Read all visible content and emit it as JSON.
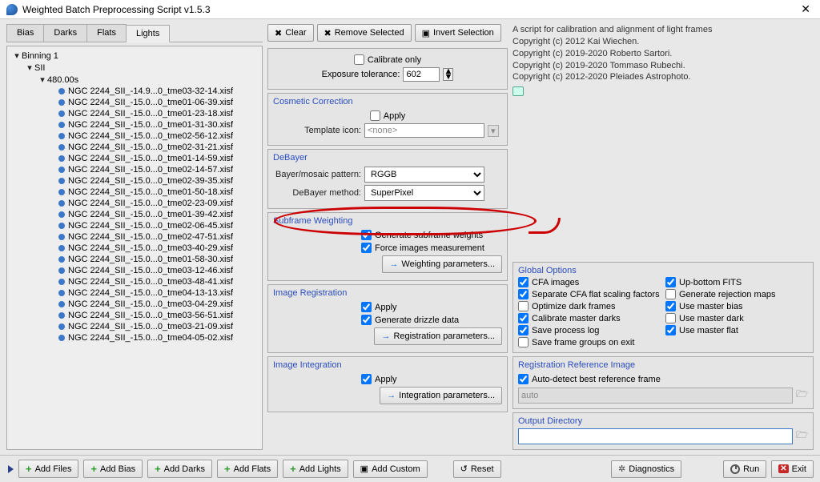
{
  "window": {
    "title": "Weighted Batch Preprocessing Script v1.5.3"
  },
  "tabs": [
    "Bias",
    "Darks",
    "Flats",
    "Lights"
  ],
  "active_tab": 3,
  "tree": {
    "root": "Binning 1",
    "filter": "SII",
    "exposure": "480.00s",
    "files": [
      "NGC 2244_SII_-14.9...0_tme03-32-14.xisf",
      "NGC 2244_SII_-15.0...0_tme01-06-39.xisf",
      "NGC 2244_SII_-15.0...0_tme01-23-18.xisf",
      "NGC 2244_SII_-15.0...0_tme01-31-30.xisf",
      "NGC 2244_SII_-15.0...0_tme02-56-12.xisf",
      "NGC 2244_SII_-15.0...0_tme02-31-21.xisf",
      "NGC 2244_SII_-15.0...0_tme01-14-59.xisf",
      "NGC 2244_SII_-15.0...0_tme02-14-57.xisf",
      "NGC 2244_SII_-15.0...0_tme02-39-35.xisf",
      "NGC 2244_SII_-15.0...0_tme01-50-18.xisf",
      "NGC 2244_SII_-15.0...0_tme02-23-09.xisf",
      "NGC 2244_SII_-15.0...0_tme01-39-42.xisf",
      "NGC 2244_SII_-15.0...0_tme02-06-45.xisf",
      "NGC 2244_SII_-15.0...0_tme02-47-51.xisf",
      "NGC 2244_SII_-15.0...0_tme03-40-29.xisf",
      "NGC 2244_SII_-15.0...0_tme01-58-30.xisf",
      "NGC 2244_SII_-15.0...0_tme03-12-46.xisf",
      "NGC 2244_SII_-15.0...0_tme03-48-41.xisf",
      "NGC 2244_SII_-15.0...0_tme04-13-13.xisf",
      "NGC 2244_SII_-15.0...0_tme03-04-29.xisf",
      "NGC 2244_SII_-15.0...0_tme03-56-51.xisf",
      "NGC 2244_SII_-15.0...0_tme03-21-09.xisf",
      "NGC 2244_SII_-15.0...0_tme04-05-02.xisf"
    ]
  },
  "top_buttons": {
    "clear": "Clear",
    "remove": "Remove Selected",
    "invert": "Invert Selection"
  },
  "calibrate_only": {
    "label": "Calibrate only",
    "checked": false
  },
  "exposure_tol": {
    "label": "Exposure tolerance:",
    "value": "602"
  },
  "cosmetic": {
    "title": "Cosmetic Correction",
    "apply": {
      "label": "Apply",
      "checked": false
    },
    "tmpl_label": "Template icon:",
    "tmpl_value": "<none>"
  },
  "debayer": {
    "title": "DeBayer",
    "pattern_label": "Bayer/mosaic pattern:",
    "pattern_value": "RGGB",
    "method_label": "DeBayer method:",
    "method_value": "SuperPixel"
  },
  "subframe": {
    "title": "Subframe Weighting",
    "gen": {
      "label": "Generate subframe weights",
      "checked": true
    },
    "force": {
      "label": "Force images measurement",
      "checked": true
    },
    "btn": "Weighting parameters..."
  },
  "registration": {
    "title": "Image Registration",
    "apply": {
      "label": "Apply",
      "checked": true
    },
    "drizzle": {
      "label": "Generate drizzle data",
      "checked": true
    },
    "btn": "Registration parameters..."
  },
  "integration": {
    "title": "Image Integration",
    "apply": {
      "label": "Apply",
      "checked": true
    },
    "btn": "Integration parameters..."
  },
  "info": {
    "l1": "A script for calibration and alignment of light frames",
    "l2": "Copyright (c) 2012 Kai Wiechen.",
    "l3": "Copyright (c) 2019-2020 Roberto Sartori.",
    "l4": "Copyright (c) 2019-2020 Tommaso Rubechi.",
    "l5": "Copyright (c) 2012-2020 Pleiades Astrophoto."
  },
  "global": {
    "title": "Global Options",
    "left": [
      {
        "label": "CFA images",
        "checked": true
      },
      {
        "label": "Separate CFA flat scaling factors",
        "checked": true
      },
      {
        "label": "Optimize dark frames",
        "checked": false
      },
      {
        "label": "Calibrate master darks",
        "checked": true
      },
      {
        "label": "Save process log",
        "checked": true
      },
      {
        "label": "Save frame groups on exit",
        "checked": false
      }
    ],
    "right": [
      {
        "label": "Up-bottom FITS",
        "checked": true
      },
      {
        "label": "Generate rejection maps",
        "checked": false
      },
      {
        "label": "Use master bias",
        "checked": true
      },
      {
        "label": "Use master dark",
        "checked": false
      },
      {
        "label": "Use master flat",
        "checked": true
      }
    ]
  },
  "ref": {
    "title": "Registration Reference Image",
    "auto": {
      "label": "Auto-detect best reference frame",
      "checked": true
    },
    "value": "auto"
  },
  "output": {
    "title": "Output Directory",
    "value": ""
  },
  "footer": {
    "add_files": "Add Files",
    "add_bias": "Add Bias",
    "add_darks": "Add Darks",
    "add_flats": "Add Flats",
    "add_lights": "Add Lights",
    "add_custom": "Add Custom",
    "reset": "Reset",
    "diag": "Diagnostics",
    "run": "Run",
    "exit": "Exit"
  }
}
